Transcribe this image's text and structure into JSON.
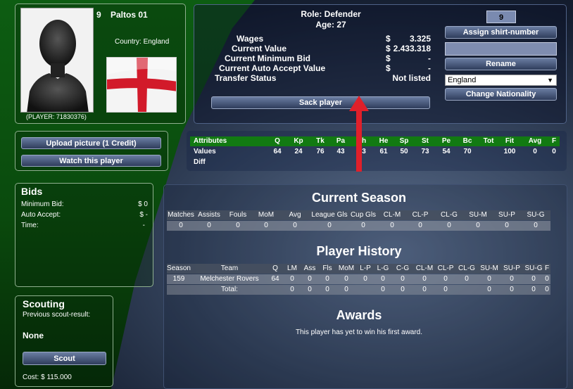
{
  "player": {
    "shirt_number": "9",
    "name": "Paltos 01",
    "country_label": "Country: England",
    "id_label": "(PLAYER: 71830376)",
    "role": "Role: Defender",
    "age": "Age: 27"
  },
  "finance": {
    "rows": [
      {
        "label": "Wages",
        "currency": "$",
        "value": "3.325"
      },
      {
        "label": "Current Value",
        "currency": "$",
        "value": "2.433.318"
      },
      {
        "label": "Current Minimum Bid",
        "currency": "$",
        "value": "-"
      },
      {
        "label": "Current Auto Accept Value",
        "currency": "$",
        "value": "-"
      },
      {
        "label": "Transfer Status",
        "currency": "",
        "value": "Not listed"
      }
    ],
    "sack_button": "Sack player"
  },
  "controls": {
    "shirt_input": "9",
    "assign_button": "Assign shirt-number",
    "rename_input": "",
    "rename_button": "Rename",
    "nationality_selected": "England",
    "change_nationality_button": "Change Nationality"
  },
  "left_buttons": {
    "upload": "Upload picture (1 Credit)",
    "watch": "Watch this player"
  },
  "attributes": {
    "headers": [
      "Attributes",
      "Q",
      "Kp",
      "Tk",
      "Pa",
      "h",
      "He",
      "Sp",
      "St",
      "Pe",
      "Bc",
      "Tot",
      "Fit",
      "Avg",
      "F"
    ],
    "values": [
      "Values",
      "64",
      "24",
      "76",
      "43",
      "3",
      "61",
      "50",
      "73",
      "54",
      "70",
      "",
      "100",
      "0",
      "0"
    ],
    "diff": [
      "Diff"
    ]
  },
  "bids": {
    "title": "Bids",
    "rows": [
      {
        "label": "Minimum Bid:",
        "value": "$ 0"
      },
      {
        "label": "Auto Accept:",
        "value": "$ -"
      },
      {
        "label": "Time:",
        "value": "-"
      }
    ]
  },
  "scouting": {
    "title": "Scouting",
    "subtitle": "Previous scout-result:",
    "result": "None",
    "button": "Scout",
    "cost": "Cost: $ 115.000"
  },
  "current_season": {
    "title": "Current Season",
    "headers": [
      "Matches",
      "Assists",
      "Fouls",
      "MoM",
      "Avg",
      "League Gls",
      "Cup Gls",
      "CL-M",
      "CL-P",
      "CL-G",
      "SU-M",
      "SU-P",
      "SU-G"
    ],
    "values": [
      "0",
      "0",
      "0",
      "0",
      "0",
      "0",
      "0",
      "0",
      "0",
      "0",
      "0",
      "0",
      "0"
    ]
  },
  "history": {
    "title": "Player History",
    "headers": [
      "Season",
      "Team",
      "Q",
      "LM",
      "Ass",
      "Fls",
      "MoM",
      "L-P",
      "L-G",
      "C-G",
      "CL-M",
      "CL-P",
      "CL-G",
      "SU-M",
      "SU-P",
      "SU-G",
      "F"
    ],
    "rows": [
      [
        "159",
        "Melchester Rovers",
        "64",
        "0",
        "0",
        "0",
        "0",
        "0",
        "0",
        "0",
        "0",
        "0",
        "0",
        "0",
        "0",
        "0",
        "0"
      ],
      [
        "",
        "Total:",
        "",
        "0",
        "0",
        "0",
        "0",
        "",
        "0",
        "0",
        "0",
        "0",
        "",
        "0",
        "0",
        "0",
        "0"
      ]
    ]
  },
  "awards": {
    "title": "Awards",
    "text": "This player has yet to win his first award."
  },
  "colors": {
    "arrow": "#e0202a",
    "attr_bar": "#127a12"
  }
}
